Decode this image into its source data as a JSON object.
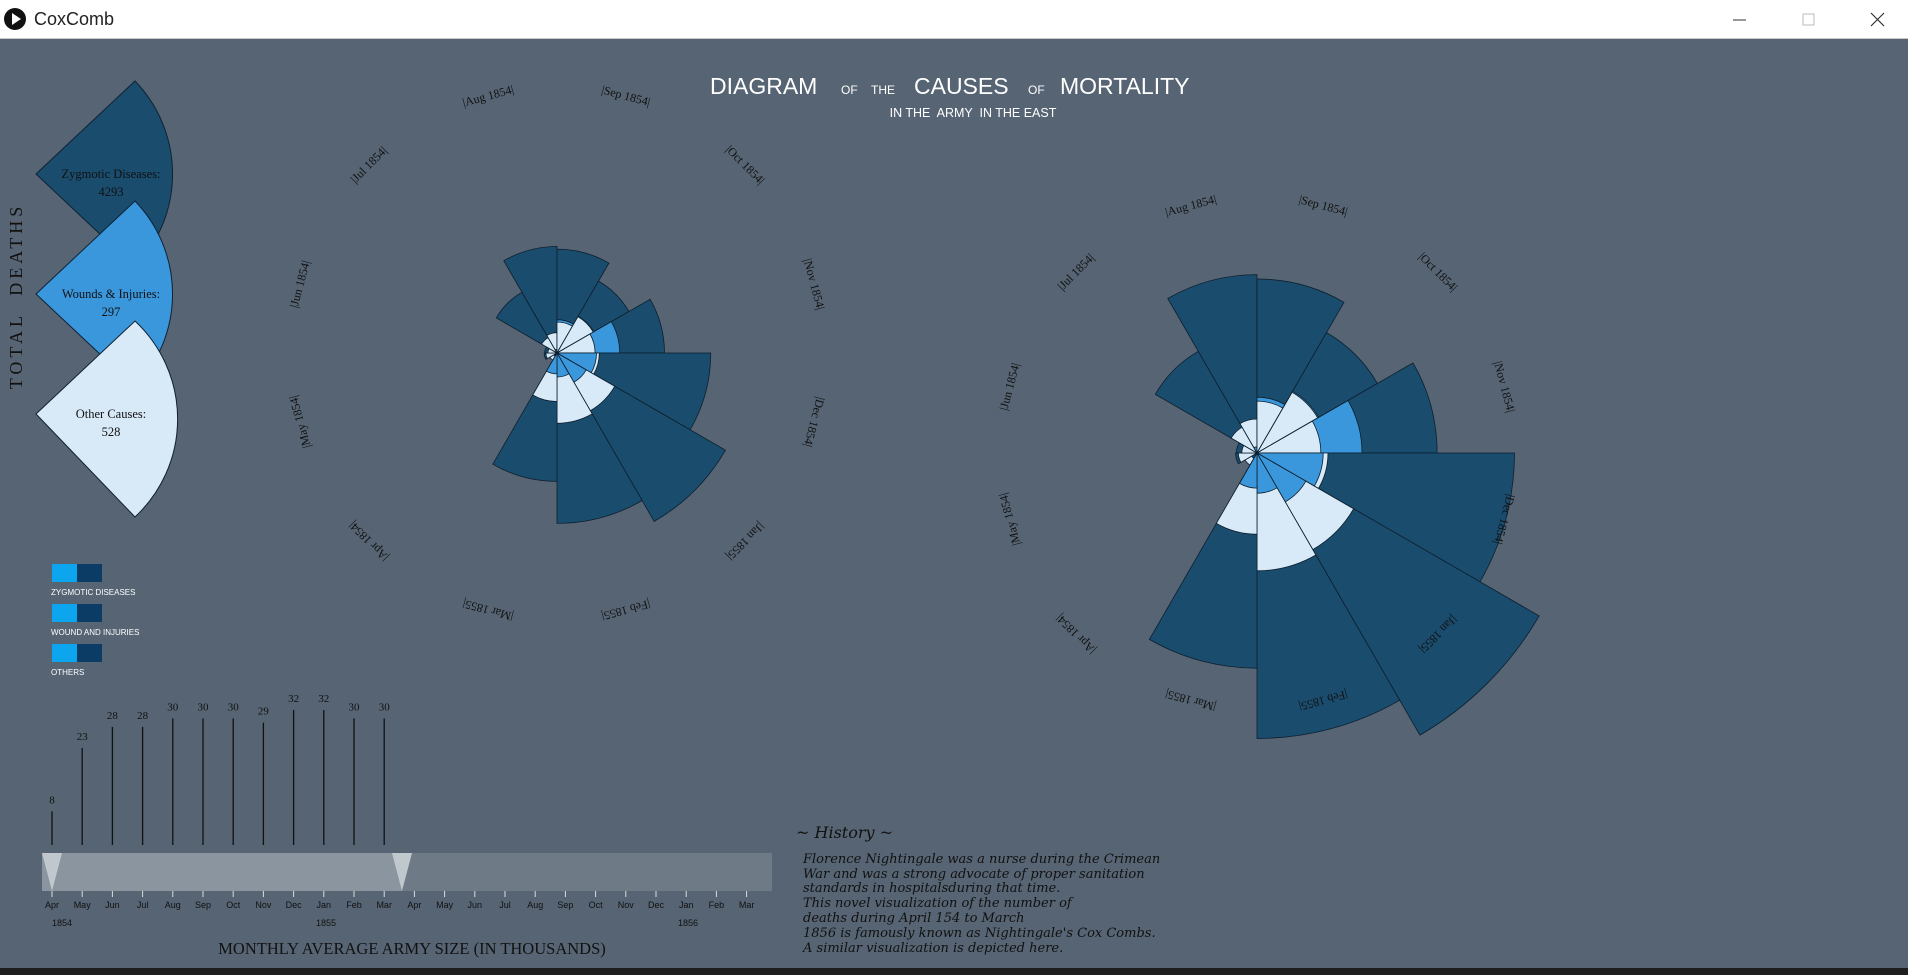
{
  "window": {
    "title": "CoxComb"
  },
  "colors": {
    "background": "#566473",
    "zymotic": "#1a4c6e",
    "wounds": "#3a97dc",
    "other": "#d8e9f8",
    "legend_light": "#0ea5ef",
    "legend_dark": "#0a3c66"
  },
  "title": {
    "w1": "DIAGRAM",
    "w2": "OF",
    "w3": "THE",
    "w4": "CAUSES",
    "w5": "OF",
    "w6": "MORTALITY",
    "sub": "IN THE  ARMY  IN THE EAST"
  },
  "side_label": "TOTAL  DEATHS",
  "totals": [
    {
      "label": "Zygmotic Diseases:",
      "value": "4293"
    },
    {
      "label": "Wounds & Injuries:",
      "value": "297"
    },
    {
      "label": "Other Causes:",
      "value": "528"
    }
  ],
  "legend": [
    "ZYGMOTIC DISEASES",
    "WOUND AND INJURIES",
    "OTHERS"
  ],
  "army": {
    "label": "MONTHLY AVERAGE ARMY SIZE (IN THOUSANDS)",
    "values": [
      8,
      23,
      28,
      28,
      30,
      30,
      30,
      29,
      32,
      32,
      30,
      30
    ]
  },
  "timeline": {
    "months": [
      "Apr",
      "May",
      "Jun",
      "Jul",
      "Aug",
      "Sep",
      "Oct",
      "Nov",
      "Dec",
      "Jan",
      "Feb",
      "Mar",
      "Apr",
      "May",
      "Jun",
      "Jul",
      "Aug",
      "Sep",
      "Oct",
      "Nov",
      "Dec",
      "Jan",
      "Feb",
      "Mar"
    ],
    "years": [
      "1854",
      "1855",
      "1856"
    ]
  },
  "history": {
    "title": "~ History ~",
    "lines": [
      "Florence Nightingale was a nurse during the Crimean",
      "War and was a strong advocate of proper sanitation",
      "standards in hospitalsduring that time.",
      "This novel visualization of the number of",
      "deaths during April 154 to March",
      "1856 is famously known as Nightingale's Cox Combs.",
      "A similar visualization is depicted here."
    ]
  },
  "small_chart": {
    "labels": [
      "|Apr 1854|",
      "|May 1854|",
      "|Jun 1854|",
      "|Jul 1854|",
      "|Aug 1854|",
      "|Sep 1854|",
      "|Oct 1854|",
      "|Nov 1854|",
      "|Dec 1854|",
      "|Jan 1855|",
      "|Feb 1855|",
      "|Mar 1855|"
    ],
    "zymotic": [
      1,
      12,
      11,
      359,
      828,
      788,
      503,
      844,
      1725,
      2761,
      2120,
      1205
    ],
    "wounds": [
      0,
      0,
      0,
      0,
      1,
      81,
      132,
      287,
      114,
      83,
      42,
      32
    ],
    "other": [
      5,
      9,
      6,
      23,
      30,
      70,
      128,
      106,
      131,
      324,
      361,
      172
    ]
  },
  "big_chart": {
    "labels": [
      "|Apr 1854|",
      "|May 1854|",
      "|Jun 1854|",
      "|Jul 1854|",
      "|Aug 1854|",
      "|Sep 1854|",
      "|Oct 1854|",
      "|Nov 1854|",
      "|Dec 1854|",
      "|Jan 1855|",
      "|Feb 1855|",
      "|Mar 1855|"
    ],
    "zymotic": [
      1,
      12,
      11,
      359,
      828,
      788,
      503,
      844,
      1725,
      2761,
      2120,
      1205
    ],
    "wounds": [
      0,
      0,
      0,
      0,
      1,
      81,
      132,
      287,
      114,
      83,
      42,
      32
    ],
    "other": [
      5,
      9,
      6,
      23,
      30,
      70,
      128,
      106,
      131,
      324,
      361,
      172
    ]
  }
}
